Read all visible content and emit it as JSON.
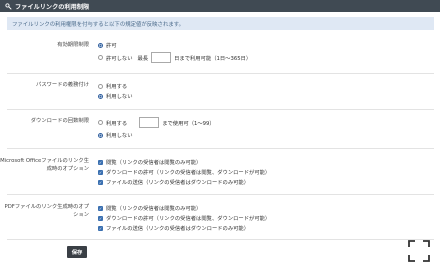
{
  "title": "ファイルリンクの利用制限",
  "notice": "ファイルリンクの利用権限を付与すると以下の規定値が反映されます。",
  "expiry": {
    "label": "有効期限制限",
    "opt_allow": "許可",
    "opt_deny": "許可しない",
    "max_prefix": "最長",
    "max_value": "",
    "max_suffix": "日まで利用可能（1日〜365日）"
  },
  "password": {
    "label": "パスワードの義務付け",
    "opt_use": "利用する",
    "opt_nouse": "利用しない"
  },
  "download_limit": {
    "label": "ダウンロードの回数制限",
    "opt_use": "利用する",
    "count_value": "",
    "count_suffix": "まで使用可（1〜99）",
    "opt_nouse": "利用しない"
  },
  "office": {
    "label_line1": "Microsoft Officeファイルのリンク生",
    "label_line2": "成時のオプション",
    "options": [
      "閲覧（リンクの受信者は閲覧のみ可能）",
      "ダウンロードの許可（リンクの受信者は閲覧、ダウンロードが可能）",
      "ファイルの送信（リンクの受信者はダウンロードのみ可能）"
    ]
  },
  "pdf": {
    "label": "PDFファイルのリンク生成時のオプション",
    "options": [
      "閲覧（リンクの受信者は閲覧のみ可能）",
      "ダウンロードの許可（リンクの受信者は閲覧、ダウンロードが可能）",
      "ファイルの送信（リンクの受信者はダウンロードのみ可能）"
    ]
  },
  "save_label": "保存",
  "colors": {
    "header_bg": "#404a53",
    "notice_bg": "#dfe8f4",
    "accent": "#3a6fb0",
    "save_bg": "#3a3f45"
  }
}
